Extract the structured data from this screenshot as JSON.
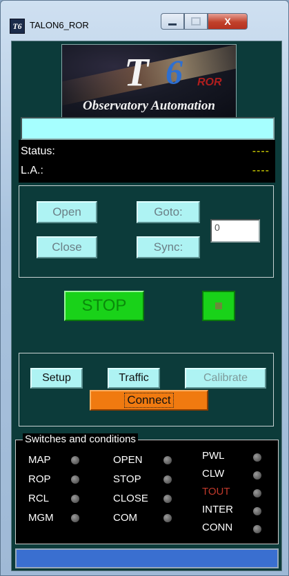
{
  "window": {
    "title": "TALON6_ROR",
    "app_icon_text": "T6",
    "close_glyph": "X"
  },
  "logo": {
    "t_letter": "T",
    "six": "6",
    "ror": "ROR",
    "tagline": "Observatory Automation"
  },
  "status": {
    "status_label": "Status:",
    "status_value": "----",
    "la_label": "L.A.:",
    "la_value": "----"
  },
  "controls": {
    "open_label": "Open",
    "close_label": "Close",
    "goto_label": "Goto:",
    "sync_label": "Sync:",
    "position_value": "0"
  },
  "stop": {
    "label": "STOP"
  },
  "actions": {
    "setup_label": "Setup",
    "traffic_label": "Traffic",
    "calibrate_label": "Calibrate",
    "connect_label": "Connect"
  },
  "switches": {
    "legend": "Switches and conditions",
    "col1": [
      "MAP",
      "ROP",
      "RCL",
      "MGM"
    ],
    "col2": [
      "OPEN",
      "STOP",
      "CLOSE",
      "COM"
    ],
    "col3": [
      "PWL",
      "CLW",
      "TOUT",
      "INTER",
      "CONN"
    ]
  },
  "colors": {
    "client_bg": "#0c3b3a",
    "stop_green": "#19d219",
    "connect_orange": "#f07a10",
    "status_yellow": "#e6e600",
    "tout_red": "#c0392b",
    "bottom_bar_blue": "#3a6fd0"
  }
}
